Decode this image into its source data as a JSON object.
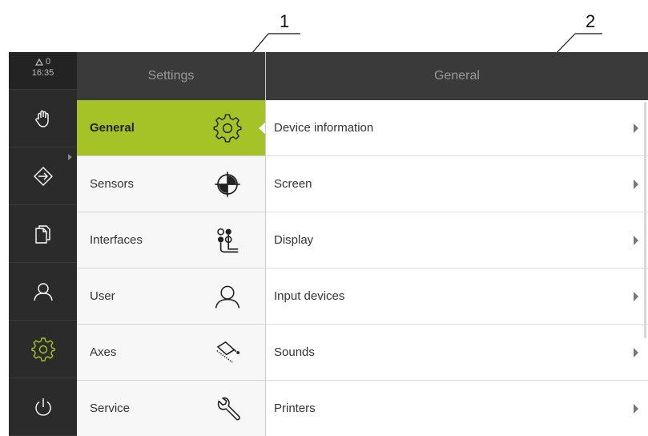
{
  "callouts": [
    "1",
    "2"
  ],
  "status": {
    "warning_count": "0",
    "time": "16:35"
  },
  "vnav": {
    "items": [
      {
        "icon": "hand-icon"
      },
      {
        "icon": "sign-in-icon"
      },
      {
        "icon": "documents-icon"
      },
      {
        "icon": "user-icon"
      },
      {
        "icon": "gear-icon"
      },
      {
        "icon": "power-icon"
      }
    ]
  },
  "settings": {
    "title": "Settings",
    "items": [
      {
        "label": "General",
        "icon": "gear-icon",
        "active": true
      },
      {
        "label": "Sensors",
        "icon": "crosshair-icon"
      },
      {
        "label": "Interfaces",
        "icon": "interfaces-icon"
      },
      {
        "label": "User",
        "icon": "user-icon"
      },
      {
        "label": "Axes",
        "icon": "axes-icon"
      },
      {
        "label": "Service",
        "icon": "wrench-icon"
      }
    ]
  },
  "general": {
    "title": "General",
    "items": [
      {
        "label": "Device information"
      },
      {
        "label": "Screen"
      },
      {
        "label": "Display"
      },
      {
        "label": "Input devices"
      },
      {
        "label": "Sounds"
      },
      {
        "label": "Printers"
      }
    ]
  },
  "colors": {
    "accent": "#a5c327",
    "nav_bg": "#2b2b2b",
    "header_bg": "#3a3a3a"
  }
}
